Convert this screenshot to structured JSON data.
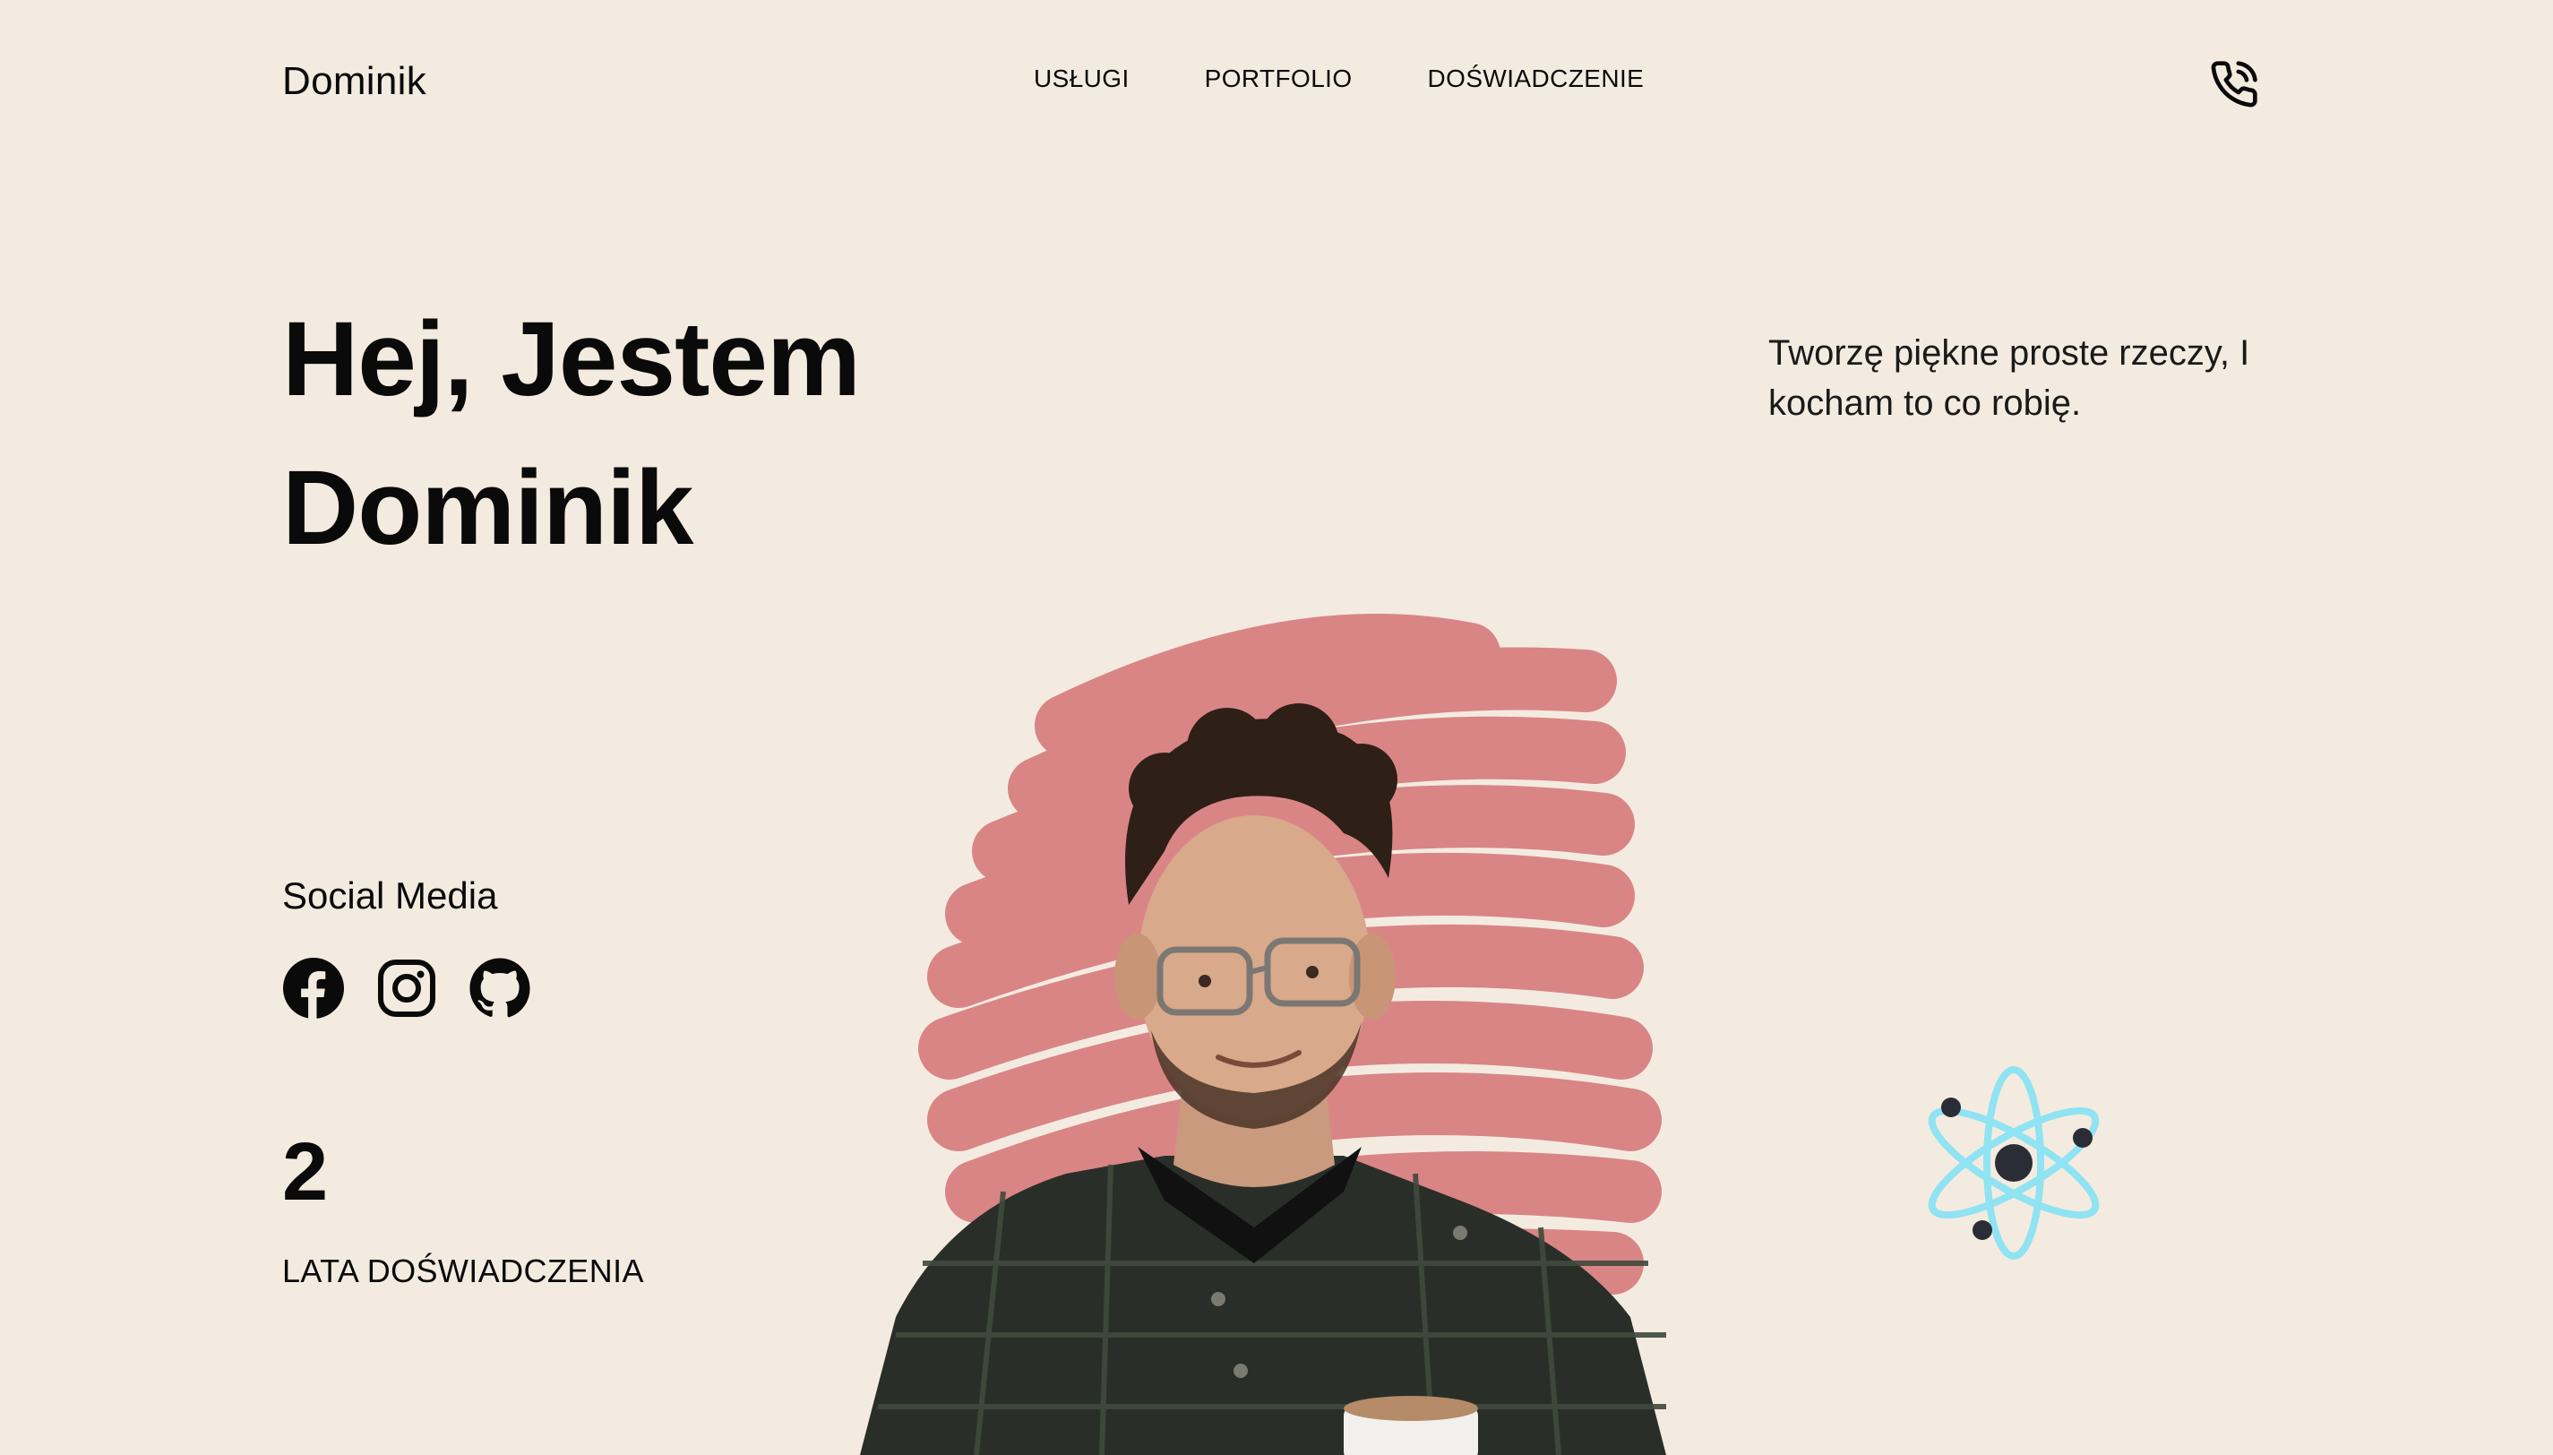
{
  "header": {
    "logo": "Dominik",
    "nav": [
      {
        "label": "USŁUGI"
      },
      {
        "label": "PORTFOLIO"
      },
      {
        "label": "DOŚWIADCZENIE"
      }
    ],
    "phone_icon": "phone-call-icon"
  },
  "hero": {
    "line1": "Hej, Jestem",
    "line2": "Dominik",
    "tagline": "Tworzę piękne proste rzeczy, I kocham to co robię."
  },
  "social": {
    "title": "Social Media",
    "icons": [
      "facebook-icon",
      "instagram-icon",
      "github-icon"
    ]
  },
  "experience": {
    "value": "2",
    "label": "LATA DOŚWIADCZENIA"
  },
  "colors": {
    "background": "#f4ebe0",
    "text": "#0a0a0a",
    "brush": "#d98585",
    "atom": "#8fe3f2",
    "atom_dots": "#2b2d36"
  }
}
